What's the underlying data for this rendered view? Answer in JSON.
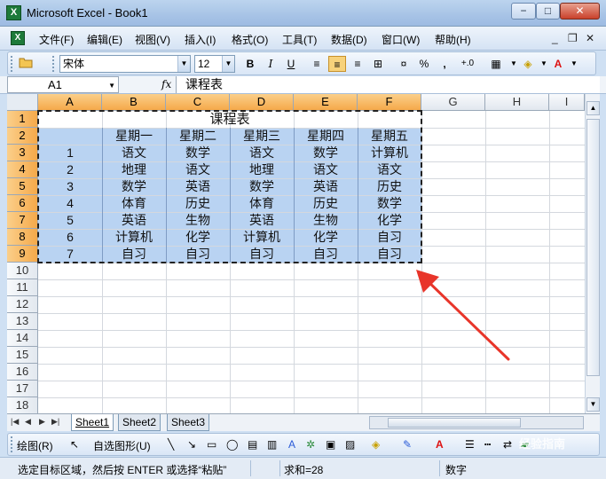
{
  "window": {
    "title": "Microsoft Excel - Book1",
    "min": "−",
    "max": "□",
    "close": "✕"
  },
  "menu": {
    "items": [
      "文件(F)",
      "编辑(E)",
      "视图(V)",
      "插入(I)",
      "格式(O)",
      "工具(T)",
      "数据(D)",
      "窗口(W)",
      "帮助(H)"
    ],
    "mdi_min": "_",
    "mdi_restore": "❐",
    "mdi_close": "✕"
  },
  "format_toolbar": {
    "font_name": "宋体",
    "font_size": "12",
    "bold": "B",
    "italic": "I",
    "underline": "U",
    "percent": "%",
    "comma": ",",
    "increase_decimal": "+.0"
  },
  "formula_bar": {
    "name_box": "A1",
    "fx": "fx",
    "formula": "课程表"
  },
  "columns": [
    "A",
    "B",
    "C",
    "D",
    "E",
    "F",
    "G",
    "H",
    "I"
  ],
  "rows": [
    "1",
    "2",
    "3",
    "4",
    "5",
    "6",
    "7",
    "8",
    "9",
    "10",
    "11",
    "12",
    "13",
    "14",
    "15",
    "16",
    "17",
    "18"
  ],
  "table": {
    "title": "课程表",
    "header": [
      "",
      "星期一",
      "星期二",
      "星期三",
      "星期四",
      "星期五"
    ],
    "body": [
      [
        "1",
        "语文",
        "数学",
        "语文",
        "数学",
        "计算机"
      ],
      [
        "2",
        "地理",
        "语文",
        "地理",
        "语文",
        "语文"
      ],
      [
        "3",
        "数学",
        "英语",
        "数学",
        "英语",
        "历史"
      ],
      [
        "4",
        "体育",
        "历史",
        "体育",
        "历史",
        "数学"
      ],
      [
        "5",
        "英语",
        "生物",
        "英语",
        "生物",
        "化学"
      ],
      [
        "6",
        "计算机",
        "化学",
        "计算机",
        "化学",
        "自习"
      ],
      [
        "7",
        "自习",
        "自习",
        "自习",
        "自习",
        "自习"
      ]
    ]
  },
  "sheet_tabs": [
    "Sheet1",
    "Sheet2",
    "Sheet3"
  ],
  "drawing_toolbar": {
    "draw": "绘图(R)",
    "autoshapes": "自选图形(U)"
  },
  "status": {
    "message": "选定目标区域，然后按 ENTER 或选择“粘贴”",
    "sum": "求和=28",
    "mode": "数字"
  },
  "watermark": "经验指南",
  "colors": {
    "selection": "#b9d3f2",
    "header_highlight": "#f5a94a",
    "arrow": "#e8352a"
  }
}
